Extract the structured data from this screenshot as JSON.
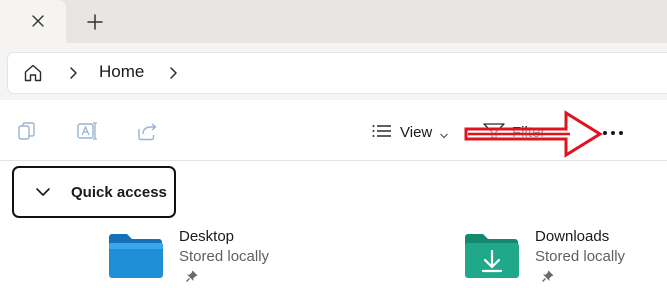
{
  "tabs": {
    "close_icon": "close-icon",
    "new_tab_icon": "plus-icon"
  },
  "address_bar": {
    "home_icon": "home-icon",
    "separator_icon": "chevron-right-icon",
    "crumbs": [
      "Home"
    ]
  },
  "command_bar": {
    "copy_icon": "copy-icon",
    "rename_icon": "rename-icon",
    "share_icon": "share-icon",
    "view_label": "View",
    "filter_label": "Filter",
    "more_icon": "ellipsis-icon",
    "annotation_color": "#e0141e"
  },
  "quick_access": {
    "header_label": "Quick access",
    "expanded": true,
    "items": [
      {
        "name": "Desktop",
        "status": "Stored locally",
        "icon": "folder-desktop-icon",
        "pinned": true
      },
      {
        "name": "Downloads",
        "status": "Stored locally",
        "icon": "folder-downloads-icon",
        "pinned": true
      }
    ]
  },
  "colors": {
    "desktop_folder": "#1e8fd6",
    "downloads_folder": "#1fa98a",
    "tabstrip_bg": "#e8e6e3"
  }
}
